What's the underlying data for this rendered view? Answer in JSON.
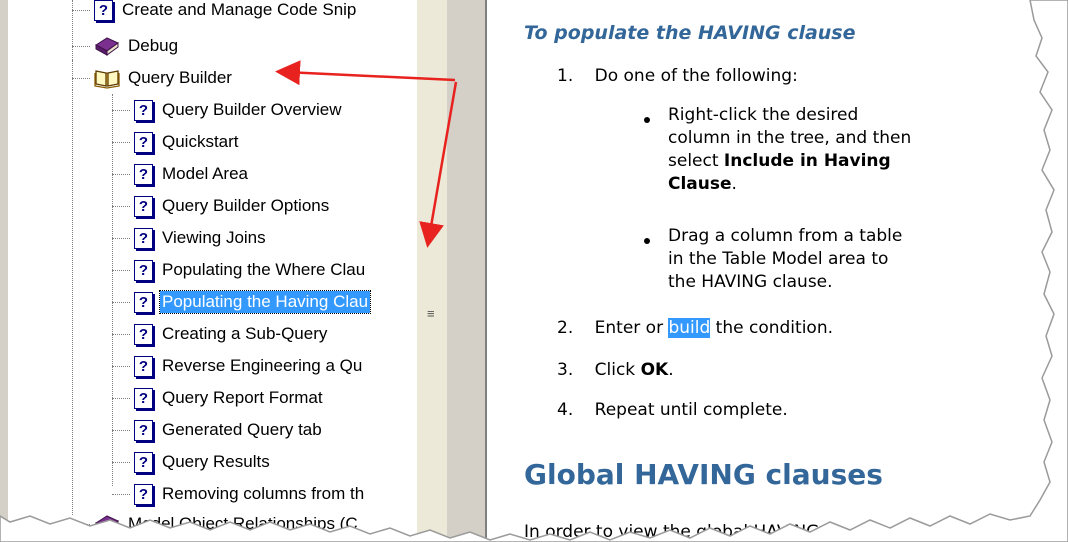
{
  "tree": {
    "items": [
      {
        "label": "Create and Manage Code Snip",
        "icon": "help-page-icon",
        "selected": false
      },
      {
        "label": "Debug",
        "icon": "closed-book-icon",
        "selected": false
      },
      {
        "label": "Query Builder",
        "icon": "open-book-icon",
        "selected": false
      },
      {
        "label": "Query Builder Overview",
        "icon": "help-page-icon",
        "selected": false
      },
      {
        "label": "Quickstart",
        "icon": "help-page-icon",
        "selected": false
      },
      {
        "label": "Model Area",
        "icon": "help-page-icon",
        "selected": false
      },
      {
        "label": "Query Builder Options",
        "icon": "help-page-icon",
        "selected": false
      },
      {
        "label": "Viewing Joins",
        "icon": "help-page-icon",
        "selected": false
      },
      {
        "label": "Populating the Where Clau",
        "icon": "help-page-icon",
        "selected": false
      },
      {
        "label": "Populating the Having Clau",
        "icon": "help-page-icon",
        "selected": true
      },
      {
        "label": "Creating a Sub-Query",
        "icon": "help-page-icon",
        "selected": false
      },
      {
        "label": "Reverse Engineering a Qu",
        "icon": "help-page-icon",
        "selected": false
      },
      {
        "label": "Query Report Format",
        "icon": "help-page-icon",
        "selected": false
      },
      {
        "label": "Generated Query tab",
        "icon": "help-page-icon",
        "selected": false
      },
      {
        "label": "Query Results",
        "icon": "help-page-icon",
        "selected": false
      },
      {
        "label": "Removing columns from th",
        "icon": "help-page-icon",
        "selected": false
      },
      {
        "label": "Model Object Relationships (C",
        "icon": "closed-book-icon",
        "selected": false
      }
    ],
    "help_glyph": "?"
  },
  "content": {
    "procedure_heading": "To populate the HAVING clause",
    "steps": [
      {
        "num": "1.",
        "text": "Do one of the following:"
      },
      {
        "num": "2.",
        "text_before": "Enter or ",
        "link": "build",
        "text_after": " the condition."
      },
      {
        "num": "3.",
        "text_before": "Click ",
        "bold": "OK",
        "text_after": "."
      },
      {
        "num": "4.",
        "text": "Repeat until complete."
      }
    ],
    "bullets": [
      {
        "lines": [
          "Right-click the desired",
          "column in the tree, and then"
        ],
        "select_prefix": "select ",
        "bold_1": "Include in Having",
        "bold_2": "Clause",
        "suffix": "."
      },
      {
        "lines": [
          "Drag a column from a table",
          "in the Table Model area to",
          "the HAVING clause."
        ]
      }
    ],
    "section_heading": "Global HAVING clauses",
    "cut_text": "In order to view the global HAVING"
  },
  "colors": {
    "heading": "#336699",
    "selection": "#3399ff",
    "arrow": "#e8231f"
  }
}
